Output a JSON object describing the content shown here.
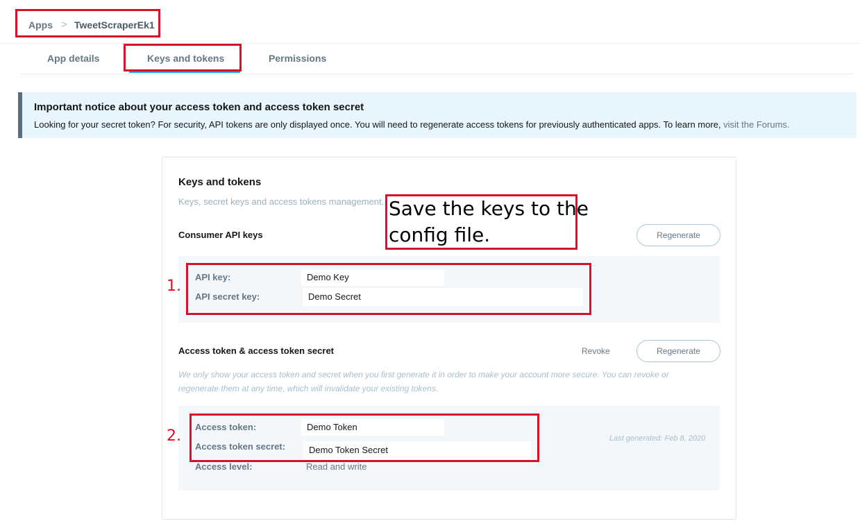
{
  "breadcrumb": {
    "root": "Apps",
    "separator": ">",
    "app_name": "TweetScraperEk1"
  },
  "tabs": [
    {
      "label": "App details"
    },
    {
      "label": "Keys and tokens"
    },
    {
      "label": "Permissions"
    }
  ],
  "notice": {
    "title": "Important notice about your access token and access token secret",
    "text": "Looking for your secret token? For security, API tokens are only displayed once. You will need to regenerate access tokens for previously authenticated apps. To learn more,",
    "link": "visit the Forums."
  },
  "card": {
    "title": "Keys and tokens",
    "subtitle": "Keys, secret keys and access tokens management.",
    "consumer": {
      "heading": "Consumer API keys",
      "regenerate_label": "Regenerate",
      "api_key_label": "API key:",
      "api_key_value": "Demo Key",
      "api_secret_label": "API secret key:",
      "api_secret_value": "Demo Secret"
    },
    "access": {
      "heading": "Access token & access token secret",
      "revoke_label": "Revoke",
      "regenerate_label": "Regenerate",
      "note_line1": "We only show your access token and secret when you first generate it in order to make your account more secure. You can revoke or",
      "note_line2": "regenerate them at any time, which will invalidate your existing tokens.",
      "token_label": "Access token:",
      "token_value": "Demo Token",
      "token_secret_label": "Access token secret:",
      "token_secret_value": "Demo Token Secret",
      "level_label": "Access level:",
      "level_value": "Read and write",
      "last_generated": "Last generated: Feb 8, 2020"
    }
  },
  "annotations": {
    "note_line1": "Save the keys to the",
    "note_line2": "config file.",
    "marker1": "1.",
    "marker2": "2.",
    "color": "#d6112a"
  }
}
